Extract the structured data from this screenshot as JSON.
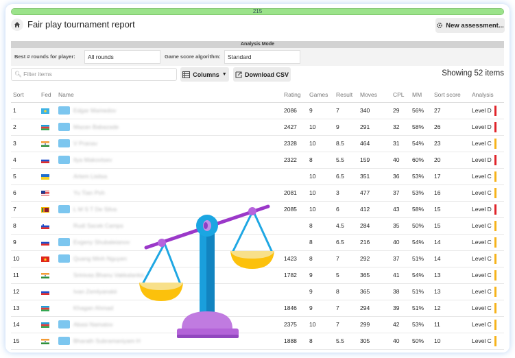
{
  "progress": {
    "value": 1.0,
    "label": "215",
    "fill_color": "#9be38a"
  },
  "header": {
    "title": "Fair play tournament report",
    "new_button_label": "New assessment..."
  },
  "analysis_mode": {
    "title": "Analysis Mode",
    "rounds_label": "Best # rounds for player:",
    "rounds_value": "All rounds",
    "algorithm_label": "Game score algorithm:",
    "algorithm_value": "Standard"
  },
  "toolbar": {
    "filter_placeholder": "Filter items",
    "columns_label": "Columns",
    "download_label": "Download CSV",
    "showing_text": "Showing 52 items"
  },
  "colors": {
    "level_d": "#e0242a",
    "level_c": "#f6b31b",
    "avatar": "#7cc6ef"
  },
  "table": {
    "columns": [
      "Sort",
      "Fed",
      "Name",
      "Rating",
      "Games",
      "Result",
      "Moves",
      "CPL",
      "MM",
      "Sort score",
      "Analysis"
    ],
    "rows": [
      {
        "sort": "1",
        "fed": "kz",
        "avatar": true,
        "name": "Edgar Mamedov",
        "rating": "2086",
        "games": "9",
        "result": "7",
        "moves": "340",
        "cpl": "29",
        "mm": "56%",
        "score": "27",
        "level": "Level D"
      },
      {
        "sort": "2",
        "fed": "az",
        "avatar": true,
        "name": "Mazan Babazade",
        "rating": "2427",
        "games": "10",
        "result": "9",
        "moves": "291",
        "cpl": "32",
        "mm": "58%",
        "score": "26",
        "level": "Level D"
      },
      {
        "sort": "3",
        "fed": "in",
        "avatar": true,
        "name": "V Pranav",
        "rating": "2328",
        "games": "10",
        "result": "8.5",
        "moves": "464",
        "cpl": "31",
        "mm": "54%",
        "score": "23",
        "level": "Level C"
      },
      {
        "sort": "4",
        "fed": "ru",
        "avatar": true,
        "name": "Ilya Makovtsev",
        "rating": "2322",
        "games": "8",
        "result": "5.5",
        "moves": "159",
        "cpl": "40",
        "mm": "60%",
        "score": "20",
        "level": "Level D"
      },
      {
        "sort": "5",
        "fed": "ua",
        "avatar": false,
        "name": "Artem Lisitsa",
        "rating": "",
        "games": "10",
        "result": "6.5",
        "moves": "351",
        "cpl": "36",
        "mm": "53%",
        "score": "17",
        "level": "Level C"
      },
      {
        "sort": "6",
        "fed": "my",
        "avatar": false,
        "name": "Yu Tian Poh",
        "rating": "2081",
        "games": "10",
        "result": "3",
        "moves": "477",
        "cpl": "37",
        "mm": "53%",
        "score": "16",
        "level": "Level C"
      },
      {
        "sort": "7",
        "fed": "lk",
        "avatar": true,
        "name": "L M S T De Silva",
        "rating": "2085",
        "games": "10",
        "result": "6",
        "moves": "412",
        "cpl": "43",
        "mm": "58%",
        "score": "15",
        "level": "Level D"
      },
      {
        "sort": "8",
        "fed": "si",
        "avatar": false,
        "name": "Rudi Sacek Camps",
        "rating": "",
        "games": "8",
        "result": "4.5",
        "moves": "284",
        "cpl": "35",
        "mm": "50%",
        "score": "15",
        "level": "Level C"
      },
      {
        "sort": "9",
        "fed": "ru",
        "avatar": true,
        "name": "Evgeny Shubaleianov",
        "rating": "",
        "games": "8",
        "result": "6.5",
        "moves": "216",
        "cpl": "40",
        "mm": "54%",
        "score": "14",
        "level": "Level C"
      },
      {
        "sort": "10",
        "fed": "vn",
        "avatar": true,
        "name": "Quang Minh Nguyen",
        "rating": "1423",
        "games": "8",
        "result": "7",
        "moves": "292",
        "cpl": "37",
        "mm": "51%",
        "score": "14",
        "level": "Level C"
      },
      {
        "sort": "11",
        "fed": "in",
        "avatar": false,
        "name": "Srinivas Bhanu Vakkalanka",
        "rating": "1782",
        "games": "9",
        "result": "5",
        "moves": "365",
        "cpl": "41",
        "mm": "54%",
        "score": "13",
        "level": "Level C"
      },
      {
        "sort": "12",
        "fed": "ru",
        "avatar": false,
        "name": "Ivan Zemlyanskii",
        "rating": "",
        "games": "9",
        "result": "8",
        "moves": "365",
        "cpl": "38",
        "mm": "51%",
        "score": "13",
        "level": "Level C"
      },
      {
        "sort": "13",
        "fed": "az",
        "avatar": false,
        "name": "Khagan Ahmad",
        "rating": "1846",
        "games": "9",
        "result": "7",
        "moves": "294",
        "cpl": "39",
        "mm": "51%",
        "score": "12",
        "level": "Level C"
      },
      {
        "sort": "14",
        "fed": "az",
        "avatar": true,
        "name": "Abasi Namatov",
        "rating": "2375",
        "games": "10",
        "result": "7",
        "moves": "299",
        "cpl": "42",
        "mm": "53%",
        "score": "11",
        "level": "Level C"
      },
      {
        "sort": "15",
        "fed": "in",
        "avatar": true,
        "name": "Bharath Subramaniyam H",
        "rating": "1888",
        "games": "8",
        "result": "5.5",
        "moves": "305",
        "cpl": "40",
        "mm": "50%",
        "score": "10",
        "level": "Level C"
      }
    ]
  }
}
